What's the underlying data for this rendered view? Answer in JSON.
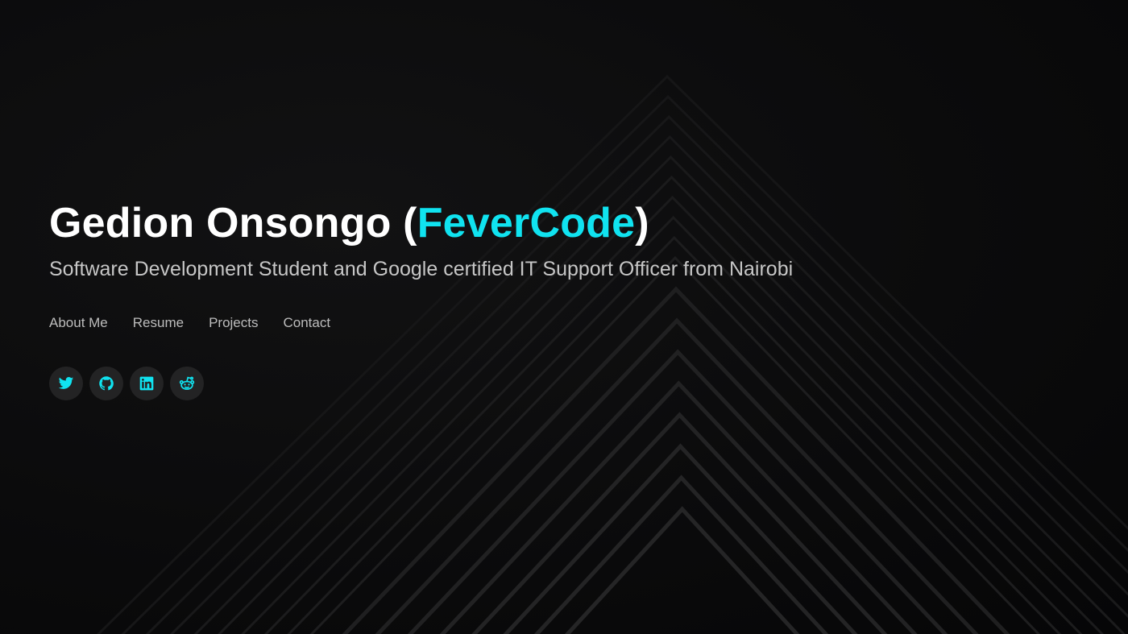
{
  "hero": {
    "name_prefix": "Gedion Onsongo (",
    "name_accent": "FeverCode",
    "name_suffix": ")",
    "tagline": "Software Development Student and Google certified IT Support Officer from Nairobi"
  },
  "nav": {
    "items": [
      {
        "label": "About Me"
      },
      {
        "label": "Resume"
      },
      {
        "label": "Projects"
      },
      {
        "label": "Contact"
      }
    ]
  },
  "socials": [
    {
      "icon": "twitter-icon"
    },
    {
      "icon": "github-icon"
    },
    {
      "icon": "linkedin-icon"
    },
    {
      "icon": "reddit-icon"
    }
  ],
  "colors": {
    "accent": "#10e3f0",
    "background": "#0b0b0c",
    "icon_circle": "#232324"
  }
}
